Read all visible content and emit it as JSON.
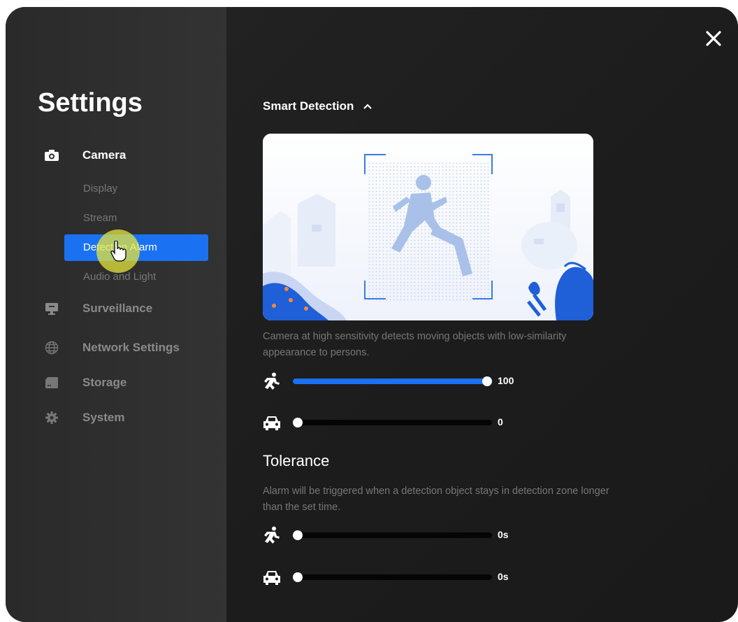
{
  "settings_title": "Settings",
  "nav": [
    {
      "label": "Camera",
      "icon": "camera-icon",
      "active": true
    },
    {
      "label": "Surveillance",
      "icon": "monitor-icon"
    },
    {
      "label": "Network Settings",
      "icon": "globe-icon"
    },
    {
      "label": "Storage",
      "icon": "storage-icon"
    },
    {
      "label": "System",
      "icon": "gear-icon"
    }
  ],
  "camera_subitems": [
    "Display",
    "Stream",
    "Detection Alarm",
    "Audio and Light"
  ],
  "selected_subitem": "Detection Alarm",
  "section_header": "Smart Detection",
  "sensitivity": {
    "description": "Camera at high sensitivity detects moving objects with low-similarity appearance to persons.",
    "person": {
      "icon": "running-person-icon",
      "value": 100,
      "max": 100,
      "label": "100"
    },
    "vehicle": {
      "icon": "car-icon",
      "value": 0,
      "max": 100,
      "label": "0"
    }
  },
  "tolerance": {
    "title": "Tolerance",
    "description": "Alarm will be triggered when a detection object stays in detection zone longer than the set time.",
    "person": {
      "icon": "running-person-icon",
      "value": 0,
      "max": 100,
      "label": "0s"
    },
    "vehicle": {
      "icon": "car-icon",
      "value": 0,
      "max": 100,
      "label": "0s"
    }
  },
  "colors": {
    "accent": "#1a72f2",
    "background": "#1e1e1e",
    "sidebar": "#2f2f2f",
    "highlight": "#e6e63c"
  }
}
